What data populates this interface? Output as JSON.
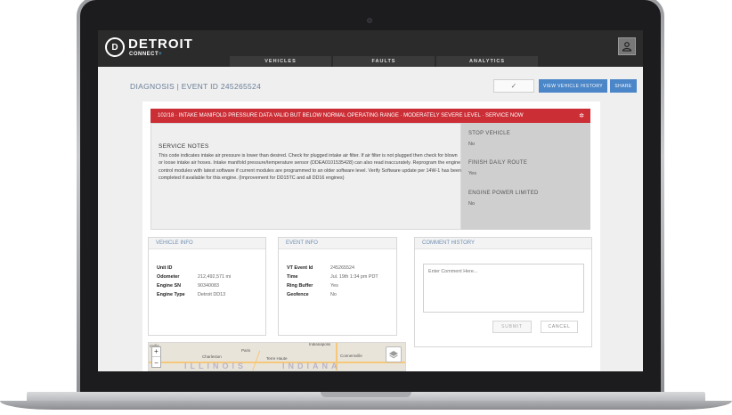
{
  "header": {
    "logo_text": "DETROIT",
    "logo_sub": "CONNECT",
    "logo_plus": "+",
    "logo_mark": "D",
    "user_icon": "user-icon"
  },
  "nav": {
    "tabs": [
      {
        "label": "VEHICLES"
      },
      {
        "label": "FAULTS"
      },
      {
        "label": "ANALYTICS"
      }
    ]
  },
  "subbar": {
    "title": "DIAGNOSIS | EVENT ID 245265524",
    "check_label": "✓",
    "history_label": "VIEW VEHICLE HISTORY",
    "share_label": "SHARE"
  },
  "fault": {
    "banner": "102/18 · INTAKE MANIFOLD PRESSURE DATA VALID BUT BELOW NORMAL OPERATING RANGE · MODERATELY SEVERE LEVEL · SERVICE NOW",
    "banner_color": "#cc2e36",
    "gear_icon": "gear-icon"
  },
  "service_notes": {
    "title": "SERVICE NOTES",
    "body": "This code indicates intake air pressure is lower than desired. Check for plugged intake air filter. If air filter is not plugged then check for blown or loose intake air hoses. Intake manifold pressure/temperature sensor (DDEA0101535428) can also read inaccurately. Reprogram the engine control modules with latest software if current modules are programmed to an older software level. Verify Software update per 14W-1 has been completed if available for this engine. (Improvement for DD15TC and all DD16 engines)"
  },
  "status": [
    {
      "label": "STOP VEHICLE",
      "value": "No"
    },
    {
      "label": "FINISH DAILY ROUTE",
      "value": "Yes"
    },
    {
      "label": "ENGINE POWER LIMITED",
      "value": "No"
    }
  ],
  "vehicle_info": {
    "title": "VEHICLE INFO",
    "rows": [
      {
        "label": "Unit ID",
        "value": ""
      },
      {
        "label": "Odometer",
        "value": "212,492,571 mi"
      },
      {
        "label": "Engine SN",
        "value": "90340083"
      },
      {
        "label": "Engine Type",
        "value": "Detroit DD13"
      }
    ]
  },
  "event_info": {
    "title": "EVENT INFO",
    "rows": [
      {
        "label": "VT Event Id",
        "value": "245265524"
      },
      {
        "label": "Time",
        "value": "Jul. 19th 1:34 pm PDT"
      },
      {
        "label": "Ring Buffer",
        "value": "Yes"
      },
      {
        "label": "Geofence",
        "value": "No"
      }
    ]
  },
  "comment_history": {
    "title": "COMMENT HISTORY",
    "placeholder": "Enter Comment Here...",
    "submit_label": "SUBMIT",
    "cancel_label": "CANCEL"
  },
  "map": {
    "state_left": "ILLINOIS",
    "state_right": "INDIANA",
    "cities": [
      "Charleston",
      "Paris",
      "Terre Haute",
      "Connersville",
      "Indianapolis",
      "rrville"
    ],
    "zoom_in": "+",
    "zoom_out": "−",
    "layers_icon": "layers-icon"
  }
}
